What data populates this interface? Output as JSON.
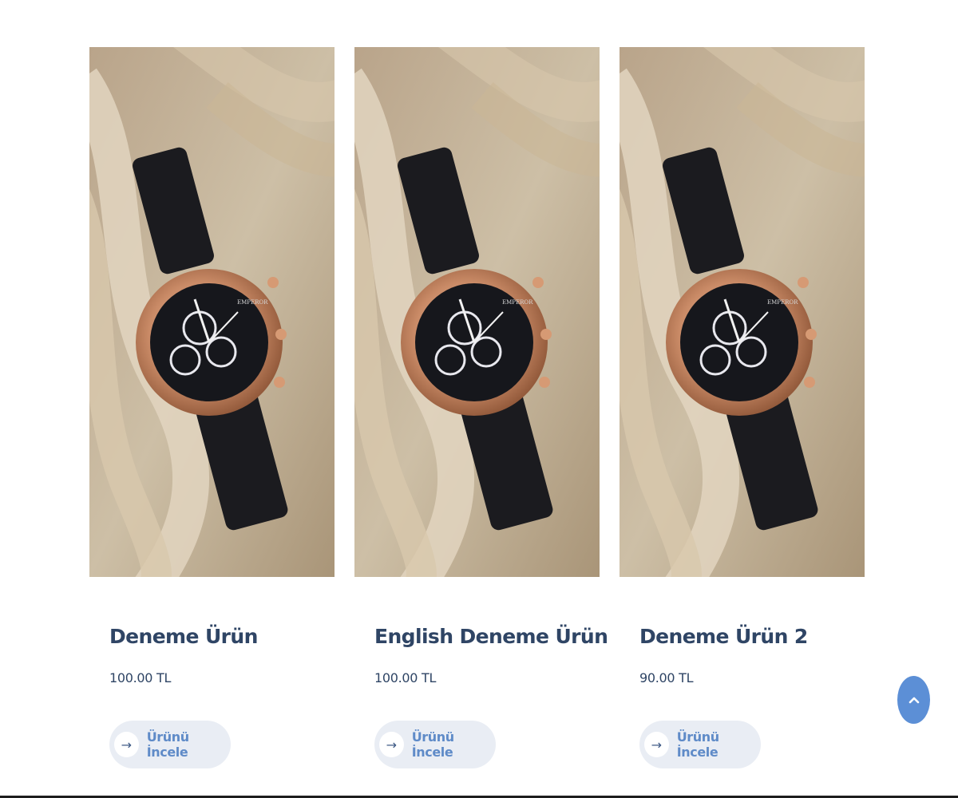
{
  "products": [
    {
      "title": "Deneme Ürün",
      "price": "100.00 TL",
      "button_label": "Ürünü İncele",
      "image_icon": "wristwatch-photo",
      "watch_brand": "EMPEROR"
    },
    {
      "title": "English Deneme Ürün",
      "price": "100.00 TL",
      "button_label": "Ürünü İncele",
      "image_icon": "wristwatch-photo",
      "watch_brand": "EMPEROR"
    },
    {
      "title": "Deneme Ürün 2",
      "price": "90.00 TL",
      "button_label": "Ürünü İncele",
      "image_icon": "wristwatch-photo",
      "watch_brand": "EMPEROR"
    }
  ],
  "button_icon": "arrow-right-icon",
  "scroll_top_icon": "chevron-up-icon",
  "colors": {
    "title": "#2f4565",
    "button_bg": "#e9edf4",
    "button_text": "#5f8bc8",
    "scroll_top_bg": "#5c8fd6"
  }
}
